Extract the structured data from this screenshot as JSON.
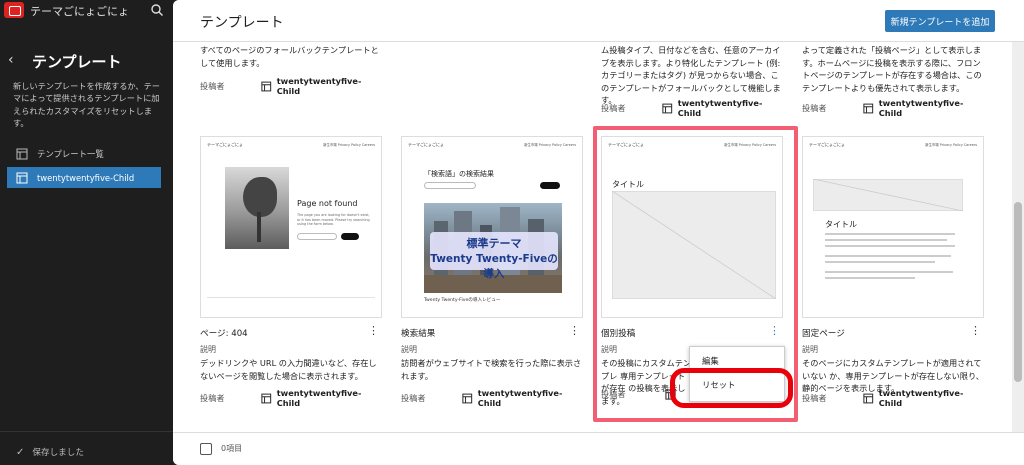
{
  "site": {
    "title": "テーマごにょごにょ"
  },
  "sidebar": {
    "title": "テンプレート",
    "description": "新しいテンプレートを作成するか、テーマによって提供されるテンプレートに加えられたカスタマイズをリセットします。",
    "items": [
      {
        "label": "テンプレート一覧"
      },
      {
        "label": "twentytwentyfive-Child"
      }
    ],
    "saved": "保存しました"
  },
  "header": {
    "title": "テンプレート",
    "add_button": "新規テンプレートを追加"
  },
  "top_cards": [
    {
      "desc": "すべてのページのフォールバックテンプレートとして使用します。",
      "author_label": "投稿者",
      "author": "twentytwentyfive-Child"
    },
    {
      "desc": "ム投稿タイプ、日付などを含む、任意のアーカイブを表示します。より特化したテンプレート (例: カテゴリーまたはタグ) が見つからない場合、このテンプレートがフォールバックとして機能します。",
      "author_label": "投稿者",
      "author": "twentytwentyfive-Child"
    },
    {
      "desc": "よって定義された「投稿ページ」として表示します。ホームページに投稿を表示する際に、フロントページのテンプレートが存在する場合は、このテンプレートよりも優先されて表示します。",
      "author_label": "投稿者",
      "author": "twentytwentyfive-Child"
    }
  ],
  "cards": [
    {
      "name": "ページ: 404",
      "desc_label": "説明",
      "desc": "デッドリンクや URL の入力間違いなど、存在しないページを閲覧した場合に表示されます。",
      "author_label": "投稿者",
      "author": "twentytwentyfive-Child",
      "thumb": {
        "site": "テーマごにょごにょ",
        "nav": "新生市場 Privacy Policy Careers",
        "heading": "Page not found",
        "body": "The page you are looking for doesn't exist, or it has been moved. Please try searching using the form below."
      }
    },
    {
      "name": "検索結果",
      "desc_label": "説明",
      "desc": "訪問者がウェブサイトで検索を行った際に表示されます。",
      "author_label": "投稿者",
      "author": "twentytwentyfive-Child",
      "thumb": {
        "site": "テーマごにょごにょ",
        "nav": "新生市場 Privacy Policy Careers",
        "heading": "「検索語」の検索結果",
        "caption": "Twenty Twenty-Fiveの導入レビュー"
      }
    },
    {
      "name": "個別投稿",
      "desc_label": "説明",
      "desc": "その投稿にカスタムテンプレ 専用テンプレートが存在 の投稿を表示します。",
      "author_label": "投稿者",
      "author": "twentytwentyfive-Child",
      "thumb": {
        "site": "テーマごにょごにょ",
        "nav": "新生市場 Privacy Policy Careers",
        "heading": "タイトル"
      }
    },
    {
      "name": "固定ページ",
      "desc_label": "説明",
      "desc": "そのページにカスタムテンプレートが適用されていない か、専用テンプレートが存在しない限り、静的ページを表示します。",
      "author_label": "投稿者",
      "author": "twentytwentyfive-Child",
      "thumb": {
        "site": "テーマごにょごにょ",
        "nav": "新生市場 Privacy Policy Careers",
        "heading": "タイトル"
      }
    }
  ],
  "overlay": {
    "line1": "標準テーマ",
    "line2": "Twenty Twenty-Fiveの導入"
  },
  "popup": {
    "edit": "編集",
    "reset": "リセット"
  },
  "footer": {
    "count": "0項目"
  },
  "colors": {
    "accent": "#2e7ab8",
    "highlight": "#f25f73",
    "ring": "#e8000a"
  }
}
